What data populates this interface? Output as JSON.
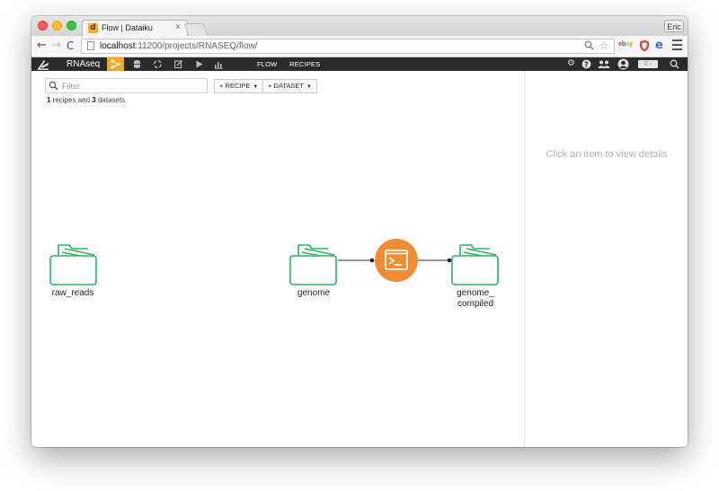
{
  "browser": {
    "tab_title": "Flow | Dataiku",
    "tab_favicon_letter": "d",
    "tab_close": "×",
    "user_chip": "Eric",
    "url_host": "localhost",
    "url_rest": ":11200/projects/RNASEQ/flow/",
    "nav": {
      "back": "←",
      "forward": "→",
      "reload": "C"
    },
    "extensions": [
      "ebay-icon",
      "shield-icon",
      "e-icon"
    ]
  },
  "dss_nav": {
    "project_name": "RNAseq",
    "links": [
      "FLOW",
      "RECIPES"
    ],
    "active_link": "FLOW",
    "notifications_label": "0",
    "icons": [
      "flow-icon",
      "datasets-icon",
      "jobs-icon",
      "notebook-icon",
      "run-icon",
      "charts-icon"
    ],
    "right_icons": [
      "settings-icon",
      "help-icon",
      "users-icon",
      "profile-icon",
      "search-icon"
    ]
  },
  "flow": {
    "filter_placeholder": "Filter",
    "summary": {
      "recipes_count": "1",
      "recipes_text": " recipes and ",
      "datasets_count": "3",
      "datasets_text": " datasets"
    },
    "buttons": {
      "recipe": "+ RECIPE",
      "dataset": "+ DATASET"
    },
    "nodes": [
      {
        "label": "raw_reads",
        "type": "dataset"
      },
      {
        "label": "genome",
        "type": "dataset"
      },
      {
        "label": "shell recipe",
        "type": "recipe"
      },
      {
        "label_line1": "genome_",
        "label_line2": "compiled",
        "type": "dataset"
      }
    ],
    "colors": {
      "dataset": "#2fb360",
      "recipe": "#f28c33",
      "accent": "#f5a623",
      "navbar": "#2b2b2b"
    }
  },
  "side_panel": {
    "placeholder": "Click an item to view details"
  }
}
